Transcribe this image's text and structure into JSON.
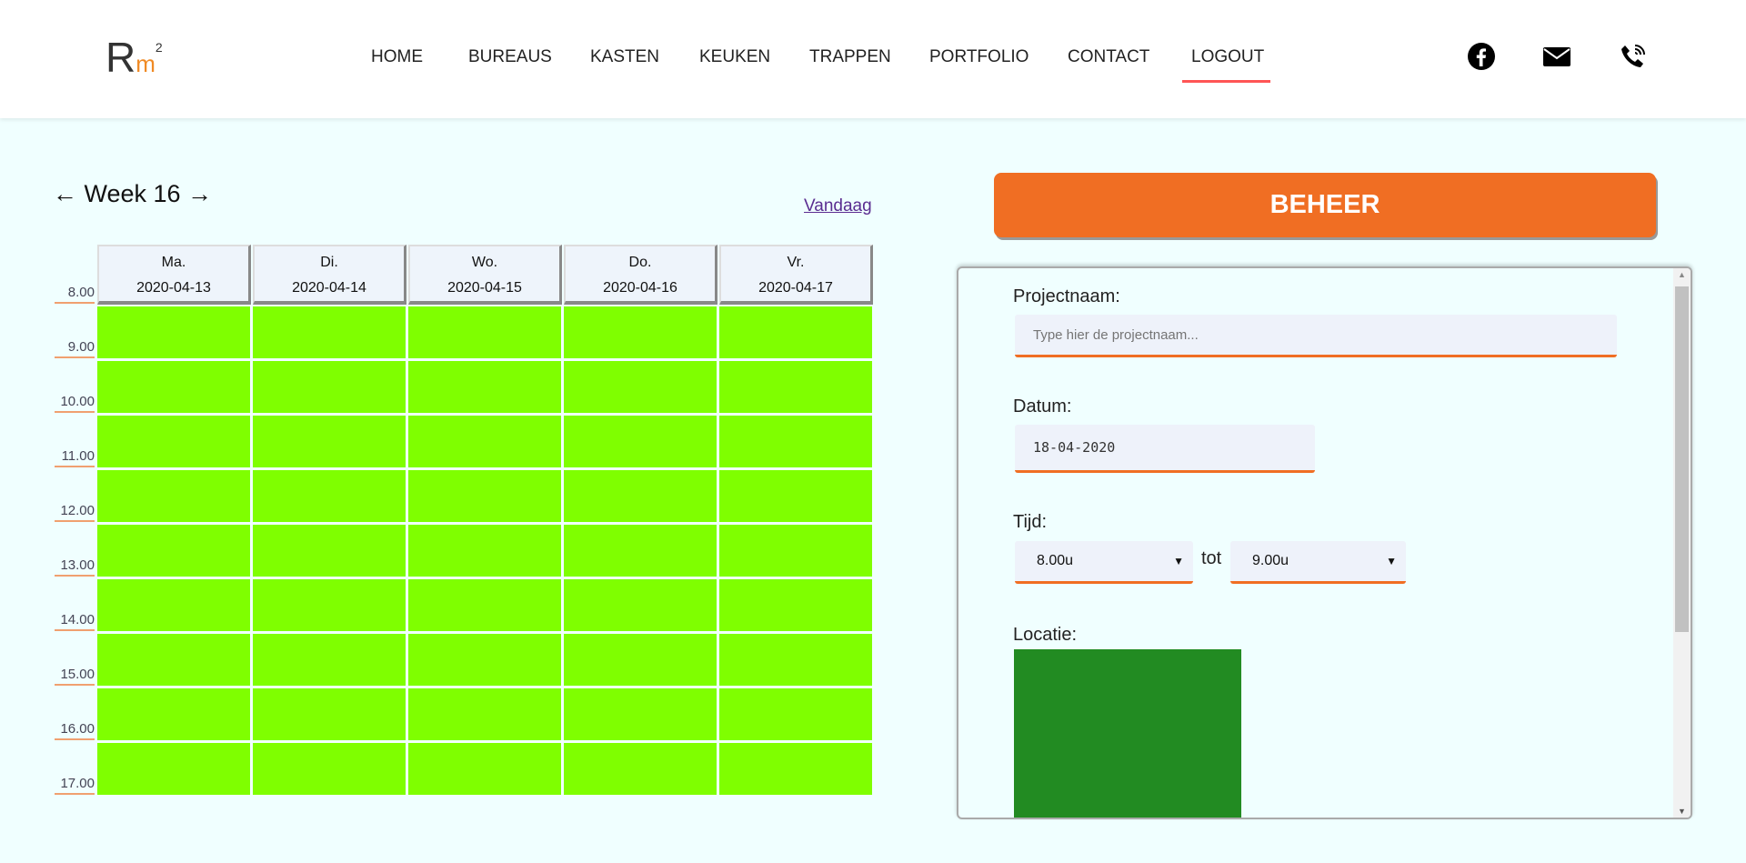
{
  "header": {
    "logo": {
      "r": "R",
      "m": "m",
      "sup": "2"
    },
    "nav": [
      {
        "label": "HOME",
        "active": false
      },
      {
        "label": "BUREAUS",
        "active": false
      },
      {
        "label": "KASTEN",
        "active": false
      },
      {
        "label": "KEUKEN",
        "active": false
      },
      {
        "label": "TRAPPEN",
        "active": false
      },
      {
        "label": "PORTFOLIO",
        "active": false
      },
      {
        "label": "CONTACT",
        "active": false
      },
      {
        "label": "LOGOUT",
        "active": true
      }
    ],
    "icons": [
      "facebook-icon",
      "mail-icon",
      "phone-icon"
    ]
  },
  "calendar": {
    "week_label": "Week 16",
    "prev": "←",
    "next": "→",
    "today_link": "Vandaag",
    "days": [
      {
        "name": "Ma.",
        "date": "2020-04-13"
      },
      {
        "name": "Di.",
        "date": "2020-04-14"
      },
      {
        "name": "Wo.",
        "date": "2020-04-15"
      },
      {
        "name": "Do.",
        "date": "2020-04-16"
      },
      {
        "name": "Vr.",
        "date": "2020-04-17"
      }
    ],
    "times": [
      "8.00",
      "9.00",
      "10.00",
      "11.00",
      "12.00",
      "13.00",
      "14.00",
      "15.00",
      "16.00",
      "17.00"
    ],
    "slot_color": "#7fff00"
  },
  "beheer": {
    "button": "BEHEER",
    "projectnaam_label": "Projectnaam:",
    "projectnaam_placeholder": "Type hier de projectnaam...",
    "projectnaam_value": "",
    "datum_label": "Datum:",
    "datum_value": "18-04-2020",
    "tijd_label": "Tijd:",
    "tijd_from": "8.00u",
    "tijd_sep": "tot",
    "tijd_to": "9.00u",
    "locatie_label": "Locatie:",
    "locatie_color": "#228b22"
  },
  "colors": {
    "accent": "#f06e23",
    "background": "#f0ffff"
  }
}
